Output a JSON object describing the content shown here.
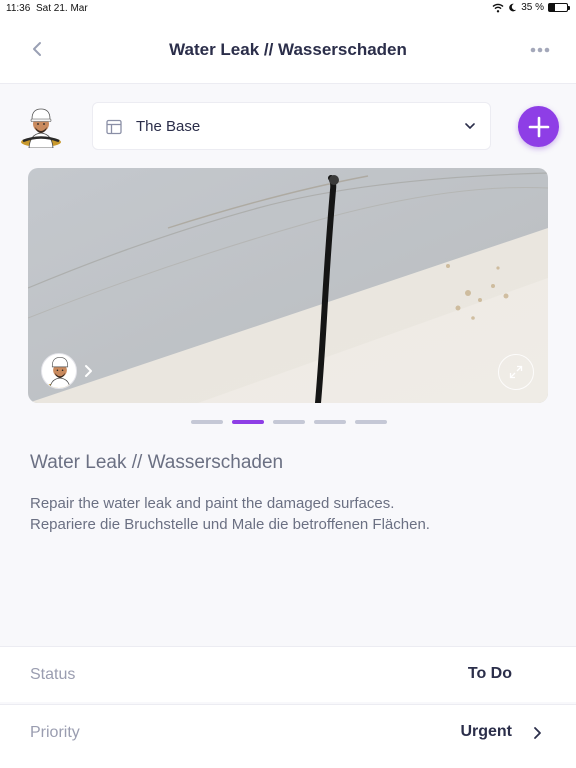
{
  "status_bar": {
    "time": "11:36",
    "date": "Sat 21. Mar",
    "battery_text": "35 %",
    "battery_level": 0.35
  },
  "nav": {
    "title": "Water Leak // Wasserschaden",
    "back_icon": "chevron-left-icon",
    "more_icon": "ellipsis-icon"
  },
  "project_selector": {
    "value": "The Base",
    "icon": "layout-icon"
  },
  "add_button": {
    "icon": "plus-icon",
    "color": "#8e3ee6"
  },
  "photo_carousel": {
    "total": 5,
    "active_index": 1
  },
  "task": {
    "title": "Water Leak // Wasserschaden",
    "description_en": "Repair the water leak and paint the damaged surfaces.",
    "description_de": "Repariere die Bruchstelle und Male die betroffenen Flächen."
  },
  "details": {
    "status_label": "Status",
    "status_value": "To Do",
    "priority_label": "Priority",
    "priority_value": "Urgent"
  },
  "colors": {
    "accent": "#8e3ee6",
    "text_primary": "#2b2e4a",
    "text_secondary": "#6b7083"
  }
}
